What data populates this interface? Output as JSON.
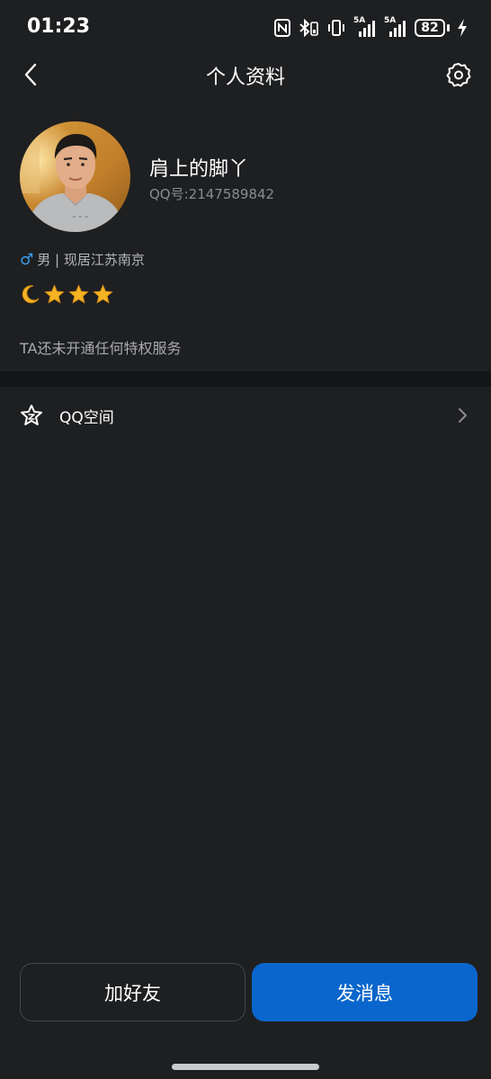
{
  "status_bar": {
    "time": "01:23",
    "signal_1_label": "5A",
    "signal_2_label": "5A",
    "battery": "82",
    "icons": [
      "nfc-icon",
      "bluetooth-icon",
      "vibrate-icon",
      "signal-icon",
      "signal-icon",
      "battery-icon",
      "charging-icon"
    ]
  },
  "nav": {
    "title": "个人资料",
    "back_icon": "back-arrow-icon",
    "settings_icon": "gear-icon"
  },
  "profile": {
    "name": "肩上的脚丫",
    "qq_number": "QQ号:2147589842",
    "gender_symbol": "♂",
    "meta": "男 | 现居江苏南京",
    "level_icons": [
      "moon-icon",
      "star-icon",
      "star-icon",
      "star-icon"
    ],
    "privilege_text": "TA还未开通任何特权服务"
  },
  "qzone": {
    "label": "QQ空间",
    "icon": "qzone-star-icon"
  },
  "actions": {
    "add_friend": "加好友",
    "send_message": "发消息"
  },
  "colors": {
    "background": "#1e1f21",
    "divider": "#141517",
    "primary_button": "#0a66cc",
    "gender_blue": "#3aa0f2",
    "star_gold": "#f5b324"
  }
}
